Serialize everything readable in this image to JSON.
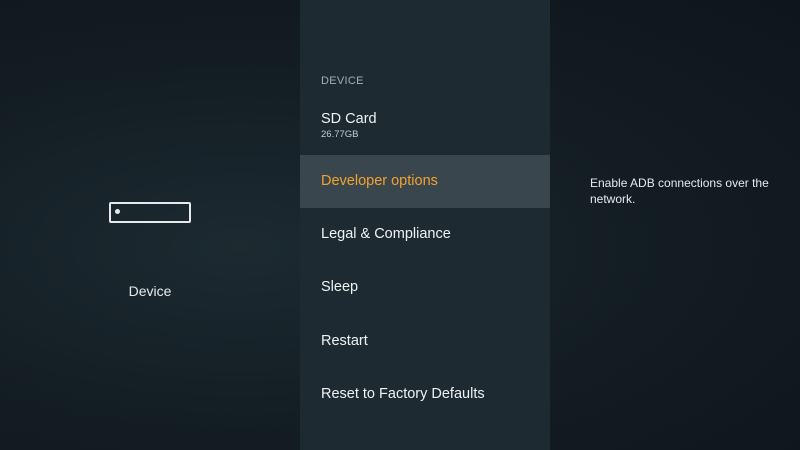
{
  "left": {
    "icon": "fire-tv-device-icon",
    "label": "Device"
  },
  "menu": {
    "section_header": "DEVICE",
    "items": [
      {
        "label": "SD Card",
        "sub": "26.77GB"
      },
      {
        "label": "Developer options",
        "selected": true
      },
      {
        "label": "Legal & Compliance"
      },
      {
        "label": "Sleep"
      },
      {
        "label": "Restart"
      },
      {
        "label": "Reset to Factory Defaults"
      }
    ]
  },
  "description": {
    "text": "Enable ADB connections over the network."
  },
  "colors": {
    "accent_selected": "#f2a32e",
    "menu_background": "#1e2a31",
    "selected_background": "#3a464d"
  }
}
